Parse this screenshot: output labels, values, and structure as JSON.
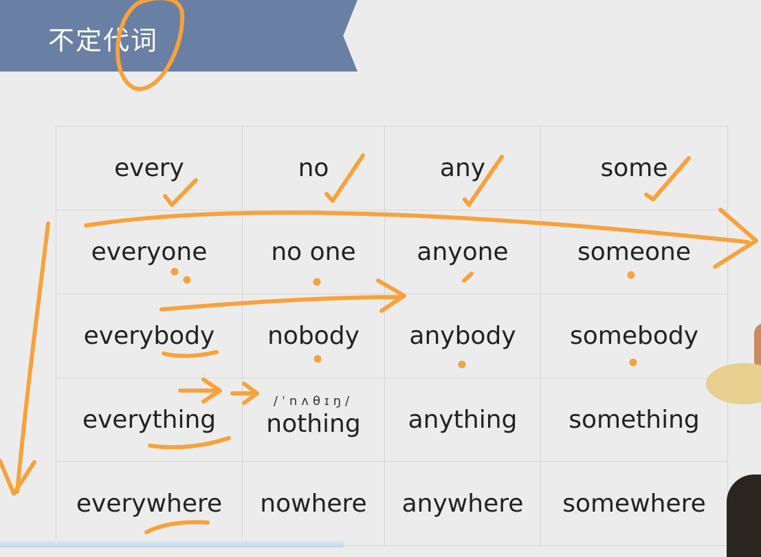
{
  "header": {
    "title": "不定代词"
  },
  "table": {
    "rows": [
      [
        "every",
        "no",
        "any",
        "some"
      ],
      [
        "everyone",
        "no one",
        "anyone",
        "someone"
      ],
      [
        "everybody",
        "nobody",
        "anybody",
        "somebody"
      ],
      [
        "everything",
        "nothing",
        "anything",
        "something"
      ],
      [
        "everywhere",
        "nowhere",
        "anywhere",
        "somewhere"
      ]
    ],
    "phonetic": "/ˈnʌθɪŋ/"
  },
  "colors": {
    "banner": "#6a7fa4",
    "annotation": "#f7a23b",
    "background": "#ececec"
  }
}
